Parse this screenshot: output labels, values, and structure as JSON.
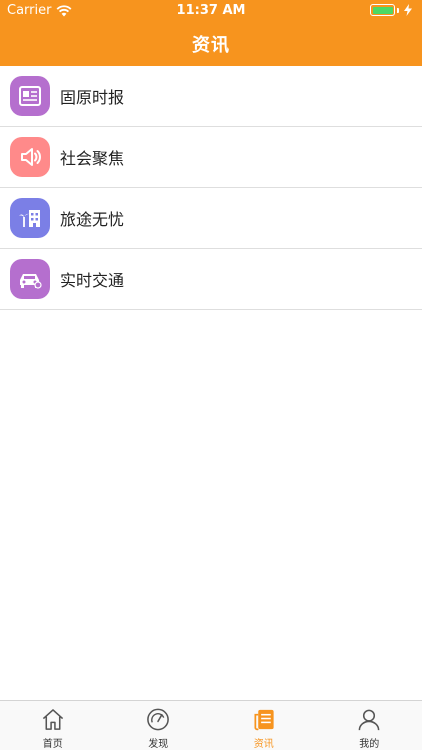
{
  "status": {
    "carrier": "Carrier",
    "time": "11:37 AM"
  },
  "nav": {
    "title": "资讯"
  },
  "list": [
    {
      "label": "固原时报",
      "icon": "newspaper-icon",
      "color": "#b56fce"
    },
    {
      "label": "社会聚焦",
      "icon": "speaker-icon",
      "color": "#ff8a8a"
    },
    {
      "label": "旅途无忧",
      "icon": "hotel-palm-icon",
      "color": "#7b7fe6"
    },
    {
      "label": "实时交通",
      "icon": "car-icon",
      "color": "#b56fce"
    }
  ],
  "tabs": [
    {
      "label": "首页",
      "icon": "home-icon",
      "active": false
    },
    {
      "label": "发现",
      "icon": "compass-icon",
      "active": false
    },
    {
      "label": "资讯",
      "icon": "news-icon",
      "active": true
    },
    {
      "label": "我的",
      "icon": "profile-icon",
      "active": false
    }
  ],
  "colors": {
    "accent": "#f7941e",
    "battery": "#4cd964"
  }
}
